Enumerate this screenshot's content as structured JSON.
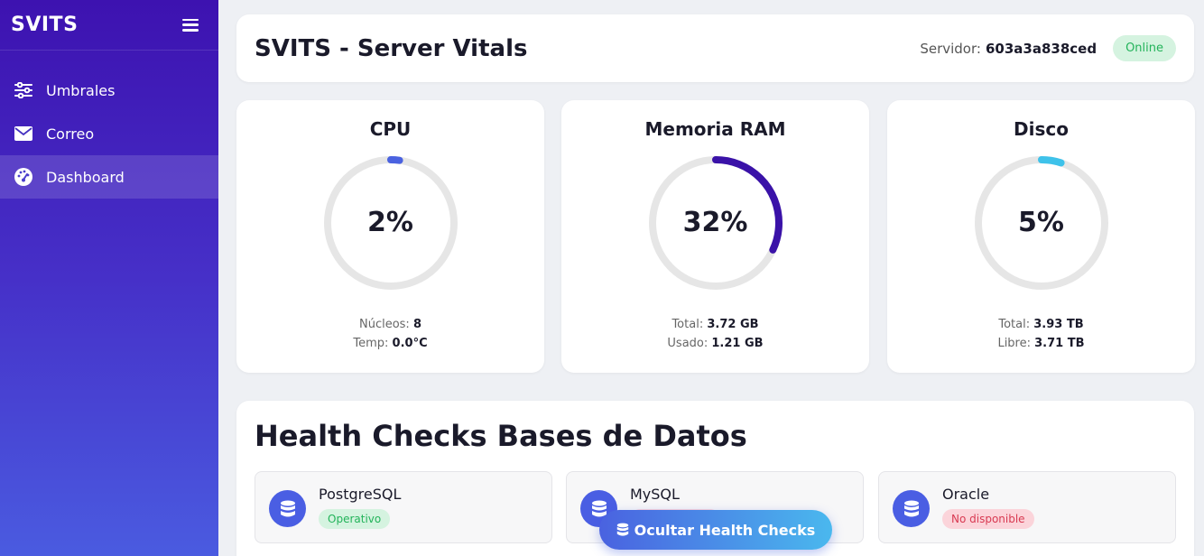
{
  "sidebar": {
    "brand": "SVITS",
    "items": [
      {
        "label": "Umbrales",
        "icon": "sliders-icon"
      },
      {
        "label": "Correo",
        "icon": "envelope-icon"
      },
      {
        "label": "Dashboard",
        "icon": "dashboard-icon",
        "active": true
      }
    ]
  },
  "header": {
    "title": "SVITS - Server Vitals",
    "server_label": "Servidor:",
    "server_id": "603a3a838ced",
    "status": "Online"
  },
  "metrics": [
    {
      "title": "CPU",
      "value_text": "2%",
      "value": 2,
      "color": "#4a62e0",
      "lines": [
        {
          "label": "Núcleos:",
          "value": "8"
        },
        {
          "label": "Temp:",
          "value": "0.0°C"
        }
      ]
    },
    {
      "title": "Memoria RAM",
      "value_text": "32%",
      "value": 32,
      "color": "#3a12a8",
      "lines": [
        {
          "label": "Total:",
          "value": "3.72 GB"
        },
        {
          "label": "Usado:",
          "value": "1.21 GB"
        }
      ]
    },
    {
      "title": "Disco",
      "value_text": "5%",
      "value": 5,
      "color": "#3ec2ea",
      "lines": [
        {
          "label": "Total:",
          "value": "3.93 TB"
        },
        {
          "label": "Libre:",
          "value": "3.71 TB"
        }
      ]
    }
  ],
  "health": {
    "title": "Health Checks Bases de Datos",
    "databases": [
      {
        "name": "PostgreSQL",
        "status": "Operativo",
        "ok": true
      },
      {
        "name": "MySQL",
        "status": "",
        "ok": false
      },
      {
        "name": "Oracle",
        "status": "No disponible",
        "ok": false
      }
    ],
    "toggle_label": "Ocultar Health Checks"
  },
  "colors": {
    "accent": "#4a5ee3",
    "ok": "#23b35a",
    "bad": "#d83a52"
  }
}
